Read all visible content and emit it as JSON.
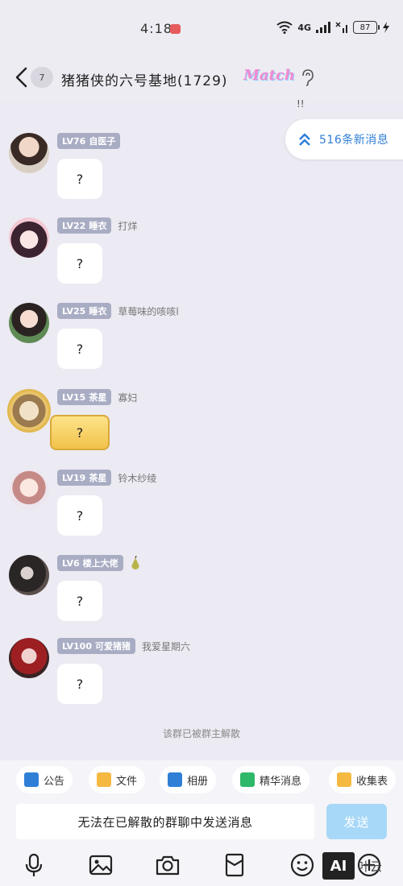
{
  "status": {
    "time": "4:18",
    "network": "4G",
    "battery": "87"
  },
  "header": {
    "unread": "7",
    "title": "猪猪侠的六号基地(1729)",
    "badge": "Match"
  },
  "faint_preview": "!!",
  "new_messages": {
    "label": "516条新消息"
  },
  "messages": [
    {
      "level": "LV76",
      "title": "自医子",
      "nick": "",
      "text": "?"
    },
    {
      "level": "LV22",
      "title": "睡衣",
      "nick": "打烊",
      "text": "?"
    },
    {
      "level": "LV25",
      "title": "睡衣",
      "nick": "草莓味的咳咳l",
      "text": "?"
    },
    {
      "level": "LV15",
      "title": "茶星",
      "nick": "寡妇",
      "text": "?"
    },
    {
      "level": "LV19",
      "title": "茶星",
      "nick": "铃木纱绫",
      "text": "?"
    },
    {
      "level": "LV6",
      "title": "楼上大佬",
      "nick": "",
      "text": "?"
    },
    {
      "level": "LV100",
      "title": "可爱猪猪",
      "nick": "我爱星期六",
      "text": "?"
    }
  ],
  "system_notice": "该群已被群主解散",
  "shortcuts": [
    {
      "label": "公告",
      "icon": "announcement-icon",
      "color": "#2f7fd6"
    },
    {
      "label": "文件",
      "icon": "folder-icon",
      "color": "#f5b942"
    },
    {
      "label": "相册",
      "icon": "album-icon",
      "color": "#2f7fd6"
    },
    {
      "label": "精华消息",
      "icon": "featured-icon",
      "color": "#2fb86a"
    },
    {
      "label": "收集表",
      "icon": "form-icon",
      "color": "#f5b942"
    }
  ],
  "input": {
    "placeholder": "无法在已解散的群聊中发送消息",
    "send_label": "发送"
  },
  "toolbar_icons": [
    "microphone-icon",
    "image-icon",
    "camera-icon",
    "red-packet-icon",
    "emoji-icon",
    "plus-icon"
  ],
  "watermark": {
    "logo": "AI",
    "text": "叶云"
  }
}
